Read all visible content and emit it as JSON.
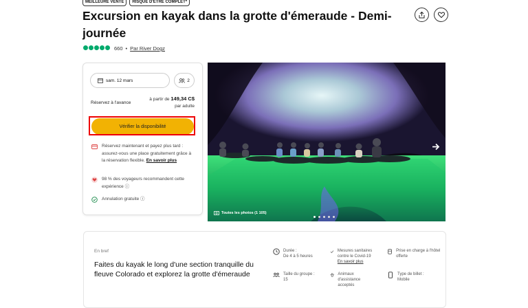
{
  "badges": [
    "MEILLEURE VENTE",
    "RISQUE D'ÊTRE COMPLET*"
  ],
  "title": "Excursion en kayak dans la grotte d'émeraude - Demi-journée",
  "rating": {
    "count": "660",
    "separator": "•",
    "by": "Par River Dogz",
    "bubbles": 5
  },
  "booking": {
    "date": "sam. 12 mars",
    "guests": "2",
    "reserve_label": "Réservez à l'avance",
    "price_prefix": "à partir de",
    "price": "149,34 C$",
    "price_unit": "par adulte",
    "check_button": "Vérifier la disponibilité"
  },
  "features": {
    "reserve_text": "Réservez maintenant et payez plus tard : assurez-vous une place gratuitement grâce à la réservation flexible.",
    "reserve_link": "En savoir plus",
    "recommend_text": "98 % des voyageurs recommandent cette expérience",
    "cancel_text": "Annulation gratuite"
  },
  "photo": {
    "label": "Toutes les photos (1 105)",
    "dots": 5,
    "active_dot": 0
  },
  "brief": {
    "label": "En bref",
    "text": "Faites du kayak le long d'une section tranquille du fleuve Colorado et explorez la grotte d'émeraude",
    "duration_label": "Durée :",
    "duration_value": "De 4 à 5 heures",
    "covid_text": "Mesures sanitaires contre le Covid-19",
    "covid_link": "En savoir plus",
    "pickup_text": "Prise en charge à l'hôtel offerte",
    "group_label": "Taille du groupe :",
    "group_value": "15",
    "animals_text": "Animaux d'assistance acceptés",
    "ticket_label": "Type de billet :",
    "ticket_value": "Mobile"
  },
  "colors": {
    "accent": "#f2b203",
    "rating": "#00aa6c",
    "highlight": "#e00000"
  },
  "icons": [
    "share-icon",
    "heart-icon",
    "calendar-icon",
    "people-icon",
    "payment-icon",
    "heart-badge-icon",
    "cancel-icon",
    "camera-icon",
    "arrow-right-icon",
    "clock-icon",
    "check-icon",
    "car-icon",
    "group-icon",
    "paw-icon",
    "phone-icon"
  ]
}
